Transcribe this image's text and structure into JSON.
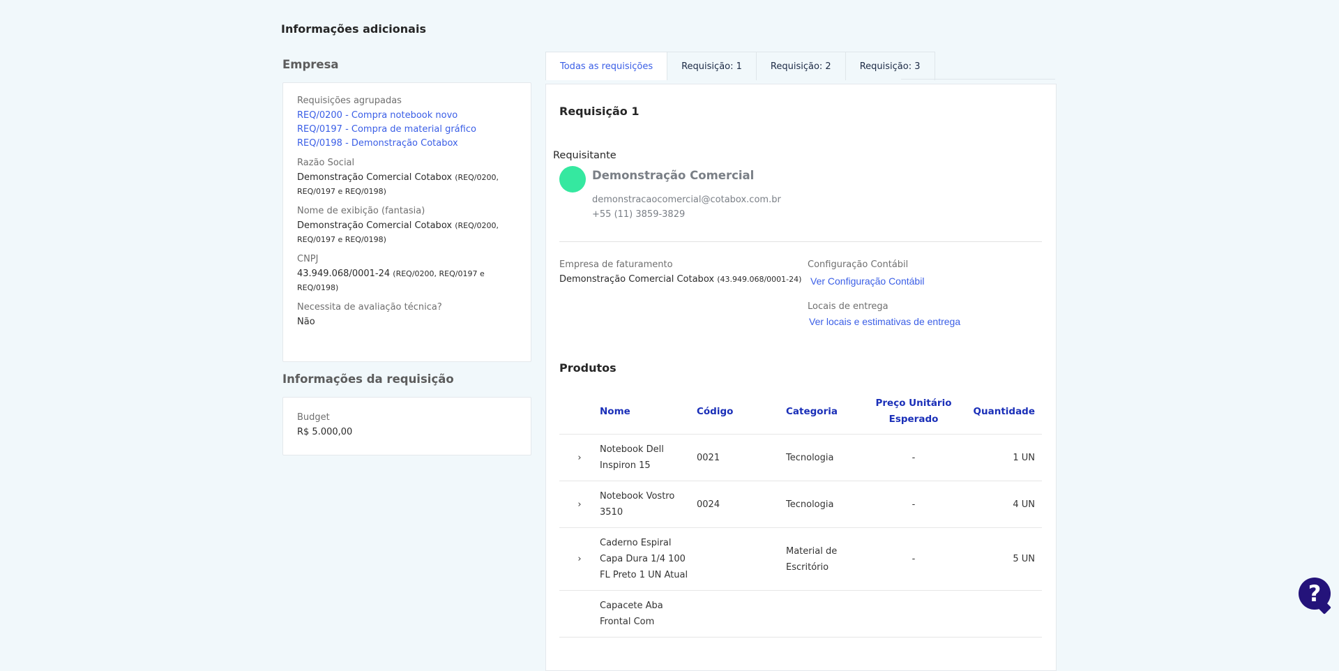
{
  "page": {
    "section_title": "Informações adicionais"
  },
  "empresa": {
    "heading": "Empresa",
    "grouped_label": "Requisições agrupadas",
    "grouped": [
      "REQ/0200 - Compra notebook novo",
      "REQ/0197 - Compra de material gráfico",
      "REQ/0198 - Demonstração Cotabox"
    ],
    "razao_label": "Razão Social",
    "razao_value": "Demonstração Comercial Cotabox",
    "razao_refs": "(REQ/0200, REQ/0197 e REQ/0198)",
    "fantasia_label": "Nome de exibição (fantasia)",
    "fantasia_value": "Demonstração Comercial Cotabox",
    "fantasia_refs": "(REQ/0200, REQ/0197 e REQ/0198)",
    "cnpj_label": "CNPJ",
    "cnpj_value": "43.949.068/0001-24",
    "cnpj_refs": "(REQ/0200, REQ/0197 e REQ/0198)",
    "avaliacao_label": "Necessita de avaliação técnica?",
    "avaliacao_value": "Não"
  },
  "info_req": {
    "heading": "Informações da requisição",
    "budget_label": "Budget",
    "budget_value": "R$ 5.000,00"
  },
  "tabs": [
    "Todas as requisições",
    "Requisição: 1",
    "Requisição: 2",
    "Requisição: 3"
  ],
  "requisicao": {
    "title": "Requisição 1",
    "requester_label": "Requisitante",
    "requester_name": "Demonstração Comercial",
    "requester_email": "demonstracaocomercial@cotabox.com.br",
    "requester_phone": "+55 (11) 3859-3829",
    "billing_label": "Empresa de faturamento",
    "billing_value": "Demonstração Comercial Cotabox",
    "billing_cnpj": "(43.949.068/0001-24)",
    "contab_label": "Configuração Contábil",
    "contab_link": "Ver Configuração Contábil",
    "locais_label": "Locais de entrega",
    "locais_link": "Ver locais e estimativas de entrega"
  },
  "produtos": {
    "title": "Produtos",
    "columns": [
      "Nome",
      "Código",
      "Categoria",
      "Preço Unitário Esperado",
      "Quantidade"
    ],
    "rows": [
      {
        "nome": "Notebook Dell Inspiron 15",
        "codigo": "0021",
        "categoria": "Tecnologia",
        "preco": "-",
        "qtd": "1 UN"
      },
      {
        "nome": "Notebook Vostro 3510",
        "codigo": "0024",
        "categoria": "Tecnologia",
        "preco": "-",
        "qtd": "4 UN"
      },
      {
        "nome": "Caderno Espiral Capa Dura 1/4 100 FL Preto 1 UN Atual",
        "codigo": "",
        "categoria": "Material de Escritório",
        "preco": "-",
        "qtd": "5 UN"
      },
      {
        "nome": "Capacete Aba Frontal Com",
        "codigo": "",
        "categoria": "",
        "preco": "",
        "qtd": ""
      }
    ]
  },
  "help_glyph": "?"
}
